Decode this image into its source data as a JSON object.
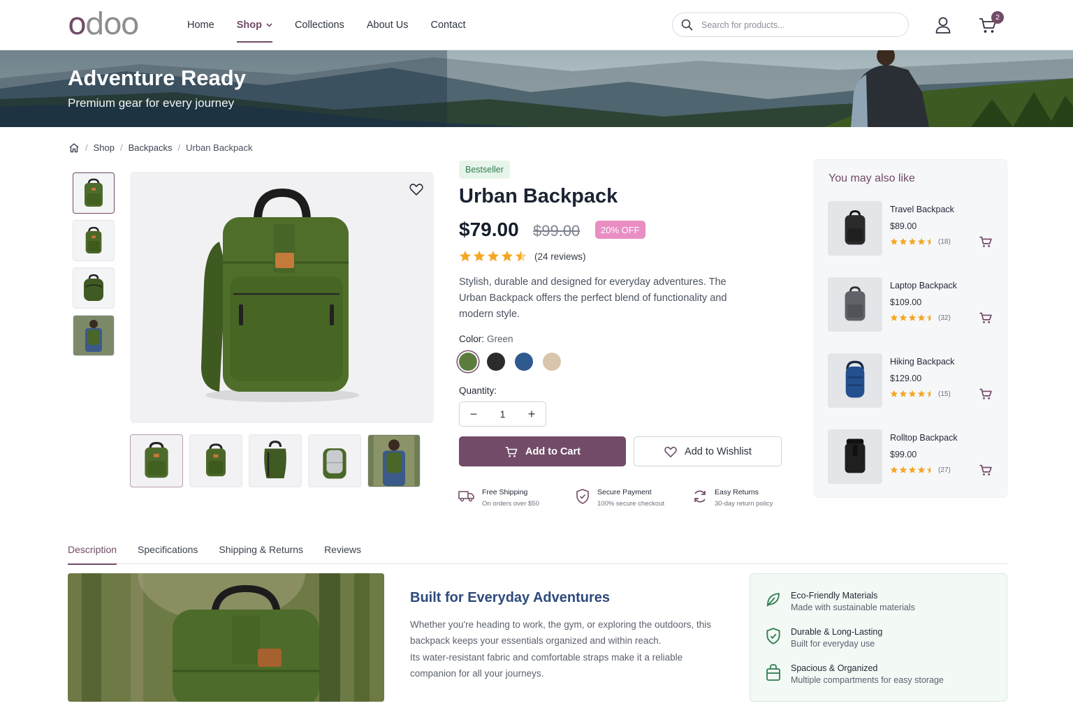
{
  "header": {
    "logo": "odoo",
    "nav": [
      {
        "label": "Home"
      },
      {
        "label": "Shop"
      },
      {
        "label": "Collections"
      },
      {
        "label": "About Us"
      },
      {
        "label": "Contact"
      }
    ],
    "active_nav": "Shop",
    "search_placeholder": "Search for products...",
    "cart_count": "2"
  },
  "hero": {
    "title": "Adventure Ready",
    "subtitle": "Premium gear for every journey"
  },
  "breadcrumb": [
    "Shop",
    "Backpacks",
    "Urban Backpack"
  ],
  "product": {
    "badge": "Bestseller",
    "title": "Urban Backpack",
    "price": "$79.00",
    "old_price": "$99.00",
    "discount": "20% OFF",
    "rating": 4.5,
    "reviews": "(24 reviews)",
    "description": "Stylish, durable and designed for everyday adventures. The Urban Backpack offers the perfect blend of functionality and modern style.",
    "color_label": "Color:",
    "color_value": "Green",
    "colors": [
      "#5b7c3d",
      "#2b2b2b",
      "#2f5a8f",
      "#d8c5ab"
    ],
    "quantity_label": "Quantity:",
    "quantity": "1",
    "add_to_cart": "Add to Cart",
    "add_to_wishlist": "Add to Wishlist",
    "features": [
      {
        "title": "Free Shipping",
        "sub": "On orders over $50",
        "icon": "truck-icon"
      },
      {
        "title": "Secure Payment",
        "sub": "100% secure checkout",
        "icon": "shield-check-icon"
      },
      {
        "title": "Easy Returns",
        "sub": "30-day return policy",
        "icon": "refresh-icon"
      }
    ]
  },
  "recommendations": {
    "title": "You may also like",
    "items": [
      {
        "name": "Travel Backpack",
        "price": "$89.00",
        "count": "(18)",
        "color": "#2b2b2b"
      },
      {
        "name": "Laptop Backpack",
        "price": "$109.00",
        "count": "(32)",
        "color": "#5f6266"
      },
      {
        "name": "Hiking Backpack",
        "price": "$129.00",
        "count": "(15)",
        "color": "#23508f"
      },
      {
        "name": "Rolltop Backpack",
        "price": "$99.00",
        "count": "(27)",
        "color": "#1f1f1f"
      }
    ]
  },
  "tabs": [
    "Description",
    "Specifications",
    "Shipping & Returns",
    "Reviews"
  ],
  "active_tab": "Description",
  "details": {
    "title": "Built for Everyday Adventures",
    "para1": "Whether you're heading to work, the gym, or exploring the outdoors, this backpack keeps your essentials organized and within reach.",
    "para2": "Its water-resistant fabric and comfortable straps make it a reliable companion for all your journeys."
  },
  "highlights": [
    {
      "title": "Eco-Friendly Materials",
      "sub": "Made with sustainable materials",
      "icon": "leaf-icon"
    },
    {
      "title": "Durable & Long-Lasting",
      "sub": "Built for everyday use",
      "icon": "shield-check-icon"
    },
    {
      "title": "Spacious & Organized",
      "sub": "Multiple compartments for easy storage",
      "icon": "bag-icon"
    }
  ],
  "colors": {
    "brand": "#714B67",
    "star": "#f5a623",
    "success": "#2e7d4f",
    "heading_blue": "#2e4a7d"
  }
}
